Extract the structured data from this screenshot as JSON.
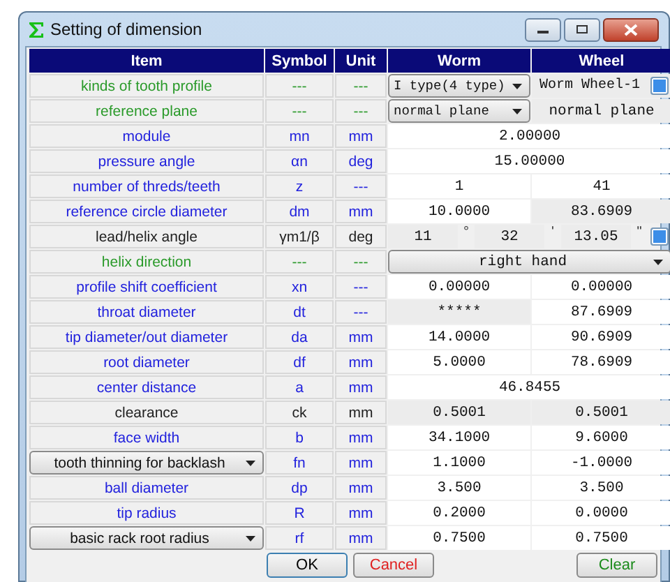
{
  "window": {
    "title": "Setting of dimension"
  },
  "columns": [
    "Item",
    "Symbol",
    "Unit",
    "Worm",
    "Wheel"
  ],
  "rows": [
    {
      "item": {
        "kind": "label",
        "text": "kinds of tooth profile"
      },
      "color": "#2a9a2a",
      "symbol": "---",
      "unit": "---",
      "worm": {
        "kind": "dropdown",
        "text": "I type(4 type)"
      },
      "wheel": {
        "kind": "readonly_button",
        "text": "Worm Wheel-1"
      }
    },
    {
      "item": {
        "kind": "label",
        "text": "reference plane"
      },
      "color": "#2a9a2a",
      "symbol": "---",
      "unit": "---",
      "worm": {
        "kind": "dropdown",
        "text": "normal plane"
      },
      "wheel": {
        "kind": "readonly",
        "text": "normal plane"
      }
    },
    {
      "item": {
        "kind": "label",
        "text": "module"
      },
      "color": "#2222dd",
      "symbol": "mn",
      "unit": "mm",
      "merged": {
        "kind": "input",
        "text": "2.00000"
      }
    },
    {
      "item": {
        "kind": "label",
        "text": "pressure angle"
      },
      "color": "#2222dd",
      "symbol": "αn",
      "unit": "deg",
      "merged": {
        "kind": "input",
        "text": "15.00000"
      }
    },
    {
      "item": {
        "kind": "label",
        "text": "number of threds/teeth"
      },
      "color": "#2222dd",
      "symbol": "z",
      "unit": "---",
      "worm": {
        "kind": "input",
        "text": "1"
      },
      "wheel": {
        "kind": "input",
        "text": "41"
      }
    },
    {
      "item": {
        "kind": "label",
        "text": "reference circle diameter"
      },
      "color": "#2222dd",
      "symbol": "dm",
      "unit": "mm",
      "worm": {
        "kind": "input",
        "text": "10.0000"
      },
      "wheel": {
        "kind": "readonly",
        "text": "83.6909"
      }
    },
    {
      "item": {
        "kind": "label",
        "text": "lead/helix angle"
      },
      "color": "#222222",
      "symbol": "γm1/β",
      "unit": "deg",
      "angle": [
        {
          "value": "11",
          "mark": "°"
        },
        {
          "value": "32",
          "mark": "'"
        },
        {
          "value": "13.05",
          "mark": "\""
        }
      ]
    },
    {
      "item": {
        "kind": "label",
        "text": "helix direction"
      },
      "color": "#2a9a2a",
      "symbol": "---",
      "unit": "---",
      "merged": {
        "kind": "dropdown",
        "text": "right hand"
      }
    },
    {
      "item": {
        "kind": "label",
        "text": "profile shift coefficient"
      },
      "color": "#2222dd",
      "symbol": "xn",
      "unit": "---",
      "worm": {
        "kind": "input",
        "text": "0.00000"
      },
      "wheel": {
        "kind": "input",
        "text": "0.00000"
      }
    },
    {
      "item": {
        "kind": "label",
        "text": "throat diameter"
      },
      "color": "#2222dd",
      "symbol": "dt",
      "unit": "---",
      "worm": {
        "kind": "readonly",
        "text": "*****"
      },
      "wheel": {
        "kind": "input",
        "text": "87.6909"
      }
    },
    {
      "item": {
        "kind": "label",
        "text": "tip diameter/out diameter"
      },
      "color": "#2222dd",
      "symbol": "da",
      "unit": "mm",
      "worm": {
        "kind": "input",
        "text": "14.0000"
      },
      "wheel": {
        "kind": "input",
        "text": "90.6909"
      }
    },
    {
      "item": {
        "kind": "label",
        "text": "root diameter"
      },
      "color": "#2222dd",
      "symbol": "df",
      "unit": "mm",
      "worm": {
        "kind": "input",
        "text": "5.0000"
      },
      "wheel": {
        "kind": "input",
        "text": "78.6909"
      }
    },
    {
      "item": {
        "kind": "label",
        "text": "center distance"
      },
      "color": "#2222dd",
      "symbol": "a",
      "unit": "mm",
      "merged": {
        "kind": "input",
        "text": "46.8455"
      }
    },
    {
      "item": {
        "kind": "label",
        "text": "clearance"
      },
      "color": "#222222",
      "symbol": "ck",
      "unit": "mm",
      "worm": {
        "kind": "readonly",
        "text": "0.5001"
      },
      "wheel": {
        "kind": "readonly",
        "text": "0.5001"
      }
    },
    {
      "item": {
        "kind": "label",
        "text": "face width"
      },
      "color": "#2222dd",
      "symbol": "b",
      "unit": "mm",
      "worm": {
        "kind": "input",
        "text": "34.1000"
      },
      "wheel": {
        "kind": "input",
        "text": "9.6000"
      }
    },
    {
      "item": {
        "kind": "dropdown",
        "text": "tooth thinning for backlash"
      },
      "color": "#2222dd",
      "symbol": "fn",
      "unit": "mm",
      "worm": {
        "kind": "input",
        "text": "1.1000"
      },
      "wheel": {
        "kind": "input",
        "text": "-1.0000"
      }
    },
    {
      "item": {
        "kind": "label",
        "text": "ball diameter"
      },
      "color": "#2222dd",
      "symbol": "dp",
      "unit": "mm",
      "worm": {
        "kind": "input",
        "text": "3.500"
      },
      "wheel": {
        "kind": "input",
        "text": "3.500"
      }
    },
    {
      "item": {
        "kind": "label",
        "text": "tip radius"
      },
      "color": "#2222dd",
      "symbol": "R",
      "unit": "mm",
      "worm": {
        "kind": "input",
        "text": "0.2000"
      },
      "wheel": {
        "kind": "input",
        "text": "0.0000"
      }
    },
    {
      "item": {
        "kind": "dropdown",
        "text": "basic rack root radius"
      },
      "color": "#2222dd",
      "symbol": "rf",
      "unit": "mm",
      "worm": {
        "kind": "input",
        "text": "0.7500"
      },
      "wheel": {
        "kind": "input",
        "text": "0.7500"
      }
    }
  ],
  "buttons": [
    {
      "label": "OK",
      "kind": "ok"
    },
    {
      "label": "Cancel",
      "kind": "cancel"
    },
    {
      "label": "Clear",
      "kind": "clear"
    }
  ]
}
